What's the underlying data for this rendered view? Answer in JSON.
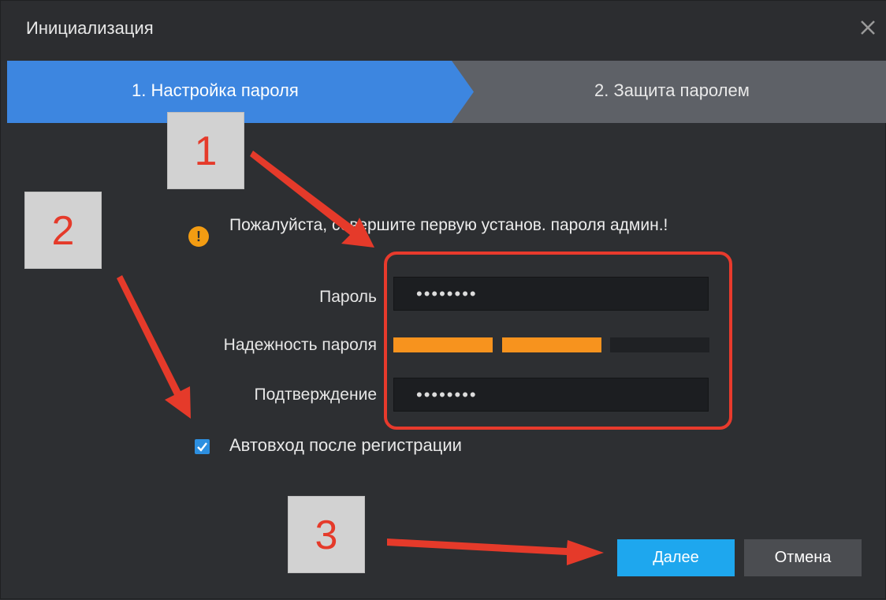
{
  "window": {
    "title": "Инициализация",
    "close_icon": "close-icon"
  },
  "steps": [
    {
      "label": "1. Настройка пароля",
      "active": true,
      "color": "#3d86e0"
    },
    {
      "label": "2. Защита паролем",
      "active": false,
      "color": "#5e6167"
    }
  ],
  "notice": {
    "icon": "warning-icon",
    "icon_glyph": "!",
    "text": "Пожалуйста, совершите первую установ. пароля админ.!"
  },
  "form": {
    "password_label": "Пароль",
    "password_value": "password",
    "strength_label": "Надежность пароля",
    "strength_level": 2,
    "strength_max": 3,
    "strength_color": "#f7931e",
    "confirm_label": "Подтверждение",
    "confirm_value": "password"
  },
  "autologin": {
    "label": "Автовход после регистрации",
    "checked": true
  },
  "buttons": {
    "next": "Далее",
    "cancel": "Отмена"
  },
  "annotations": {
    "marker1": "1",
    "marker2": "2",
    "marker3": "3",
    "color": "#e53a2a"
  }
}
